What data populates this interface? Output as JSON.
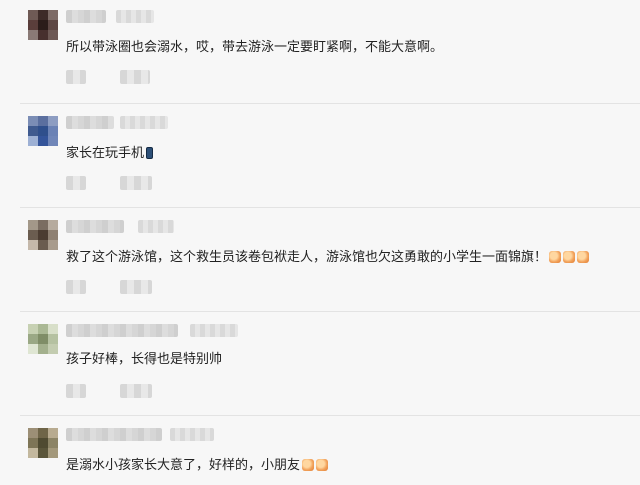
{
  "comments": [
    {
      "text": "所以带泳圈也会溺水，哎，带去游泳一定要盯紧啊，不能大意啊。",
      "icons": []
    },
    {
      "text": "家长在玩手机",
      "icons": [
        "phone-icon"
      ]
    },
    {
      "text": "救了这个游泳馆，这个救生员该卷包袱走人，游泳馆也欠这勇敢的小学生一面锦旗！",
      "icons": [
        "thumbs-up-icon",
        "thumbs-up-icon",
        "thumbs-up-icon"
      ]
    },
    {
      "text": "孩子好棒，长得也是特别帅",
      "icons": []
    },
    {
      "text": "是溺水小孩家长大意了，好样的，小朋友",
      "icons": [
        "thumbs-up-icon",
        "thumbs-up-icon"
      ]
    }
  ]
}
